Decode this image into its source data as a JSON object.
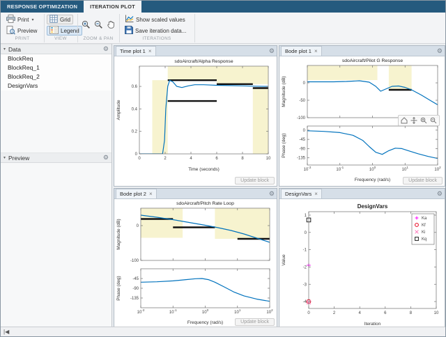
{
  "window": {
    "tab_response": "RESPONSE OPTIMIZATION",
    "tab_iteration": "ITERATION PLOT"
  },
  "toolbar": {
    "print_label": "Print",
    "preview_label": "Preview",
    "grid_label": "Grid",
    "legend_label": "Legend",
    "show_scaled_label": "Show scaled values",
    "save_iteration_label": "Save iteration data...",
    "section_print": "PRINT",
    "section_view": "VIEW",
    "section_zoom": "ZOOM & PAN",
    "section_iterations": "ITERATIONS"
  },
  "icons": {
    "gear": "⚙",
    "collapse": "▾",
    "dropdown": "▾",
    "close": "×",
    "status_nav": "|◀"
  },
  "sidebar": {
    "data_header": "Data",
    "preview_header": "Preview",
    "items": [
      "BlockReq",
      "BlockReq_1",
      "BlockReq_2",
      "DesignVars"
    ]
  },
  "panels": {
    "update_label": "Update block",
    "timeplot": {
      "tab_label": "Time plot 1"
    },
    "bode1": {
      "tab_label": "Bode plot 1"
    },
    "bode2": {
      "tab_label": "Bode plot 2"
    },
    "designvars": {
      "tab_label": "DesignVars"
    }
  },
  "statusbar": {
    "nav": "|◀"
  },
  "chart_data": [
    {
      "id": "timeplot",
      "type": "line",
      "title": "sdoAircraft/Alpha Response",
      "xlabel": "Time (seconds)",
      "ylabel": "Amplitude",
      "xscale": "linear",
      "xlim": [
        0,
        10
      ],
      "ylim": [
        0,
        0.78
      ],
      "xticks": [
        0,
        2,
        4,
        6,
        8,
        10
      ],
      "yticks": [
        0,
        0.2,
        0.4,
        0.6
      ],
      "region_color": "#f7f3cf",
      "regions": [
        [
          1,
          2.2,
          0,
          0.655
        ],
        [
          2.2,
          6,
          0.655,
          0.78
        ],
        [
          6,
          10,
          0.62,
          0.78
        ],
        [
          8.8,
          10,
          0,
          0.585
        ]
      ],
      "bounds": [
        [
          2.2,
          6,
          0.655
        ],
        [
          6,
          8.8,
          0.62
        ],
        [
          2.2,
          6,
          0.47
        ],
        [
          8.8,
          10,
          0.585
        ]
      ],
      "series": [
        {
          "name": "response",
          "color": "#0072bd",
          "points": [
            [
              0,
              0
            ],
            [
              1.8,
              0
            ],
            [
              1.95,
              0.12
            ],
            [
              2.05,
              0.4
            ],
            [
              2.2,
              0.6
            ],
            [
              2.35,
              0.655
            ],
            [
              2.6,
              0.64
            ],
            [
              2.9,
              0.6
            ],
            [
              3.3,
              0.59
            ],
            [
              3.8,
              0.605
            ],
            [
              4.3,
              0.615
            ],
            [
              5,
              0.615
            ],
            [
              6,
              0.61
            ],
            [
              7,
              0.607
            ],
            [
              8,
              0.605
            ],
            [
              9,
              0.602
            ],
            [
              10,
              0.6
            ]
          ]
        }
      ]
    },
    {
      "id": "bode1mag",
      "type": "line",
      "title": "sdoAircraft/Pilot G Response",
      "ylabel": "Magnitude (dB)",
      "xscale": "log",
      "xlim": [
        -2,
        2
      ],
      "ylim": [
        -100,
        50
      ],
      "xticks": [
        -2,
        -1,
        0,
        1,
        2
      ],
      "show_xlabels": false,
      "yticks": [
        0,
        -50,
        -100
      ],
      "regions": [
        [
          -2,
          0.15,
          8,
          50
        ],
        [
          0.5,
          1.2,
          -20,
          50
        ]
      ],
      "bounds": [
        [
          0.5,
          1.2,
          -20
        ]
      ],
      "series": [
        {
          "color": "#0072bd",
          "points": [
            [
              -2,
              3
            ],
            [
              -1.2,
              3
            ],
            [
              -0.8,
              4
            ],
            [
              -0.4,
              6
            ],
            [
              -0.1,
              2
            ],
            [
              0.1,
              -10
            ],
            [
              0.25,
              -24
            ],
            [
              0.4,
              -18
            ],
            [
              0.6,
              -10
            ],
            [
              0.8,
              -9
            ],
            [
              1,
              -13
            ],
            [
              1.2,
              -20
            ],
            [
              1.5,
              -35
            ],
            [
              1.8,
              -52
            ],
            [
              2,
              -63
            ]
          ]
        }
      ]
    },
    {
      "id": "bode1phase",
      "type": "line",
      "ylabel": "Phase (deg)",
      "xlabel": "Frequency (rad/s)",
      "xscale": "log",
      "xlim": [
        -2,
        2
      ],
      "ylim": [
        -170,
        20
      ],
      "xticks": [
        -2,
        -1,
        0,
        1,
        2
      ],
      "yticks": [
        0,
        -45,
        -90,
        -135
      ],
      "series": [
        {
          "color": "#0072bd",
          "points": [
            [
              -2,
              -3
            ],
            [
              -1.5,
              -6
            ],
            [
              -1,
              -12
            ],
            [
              -0.6,
              -25
            ],
            [
              -0.3,
              -50
            ],
            [
              -0.1,
              -80
            ],
            [
              0.1,
              -108
            ],
            [
              0.3,
              -118
            ],
            [
              0.5,
              -100
            ],
            [
              0.7,
              -88
            ],
            [
              0.9,
              -90
            ],
            [
              1.1,
              -100
            ],
            [
              1.4,
              -115
            ],
            [
              1.7,
              -128
            ],
            [
              2,
              -138
            ]
          ]
        }
      ]
    },
    {
      "id": "bode2mag",
      "type": "line",
      "title": "sdoAircraft/Pitch Rate Loop",
      "ylabel": "Magnitude (dB)",
      "xscale": "log",
      "xlim": [
        -2,
        2
      ],
      "ylim": [
        -100,
        50
      ],
      "xticks": [
        -2,
        -1,
        0,
        1,
        2
      ],
      "show_xlabels": false,
      "yticks": [
        0,
        -100
      ],
      "regions": [
        [
          -2,
          -0.7,
          -35,
          50
        ],
        [
          0.3,
          2,
          -38,
          50
        ]
      ],
      "bounds": [
        [
          -2,
          -1,
          19
        ],
        [
          -1,
          0.3,
          -5
        ],
        [
          1,
          2,
          -38
        ]
      ],
      "series": [
        {
          "color": "#0072bd",
          "points": [
            [
              -2,
              30
            ],
            [
              -1.5,
              24
            ],
            [
              -1,
              17
            ],
            [
              -0.5,
              9
            ],
            [
              0,
              1
            ],
            [
              0.4,
              -6
            ],
            [
              0.8,
              -14
            ],
            [
              1.2,
              -24
            ],
            [
              1.6,
              -36
            ],
            [
              2,
              -48
            ]
          ]
        }
      ]
    },
    {
      "id": "bode2phase",
      "type": "line",
      "ylabel": "Phase (deg)",
      "xlabel": "Frequency (rad/s)",
      "xscale": "log",
      "xlim": [
        -2,
        2
      ],
      "ylim": [
        -180,
        0
      ],
      "xticks": [
        -2,
        -1,
        0,
        1,
        2
      ],
      "yticks": [
        -45,
        -90,
        -135
      ],
      "series": [
        {
          "color": "#0072bd",
          "points": [
            [
              -2,
              -62
            ],
            [
              -1.5,
              -60
            ],
            [
              -1,
              -56
            ],
            [
              -0.6,
              -50
            ],
            [
              -0.3,
              -46
            ],
            [
              -0.1,
              -45
            ],
            [
              0.1,
              -50
            ],
            [
              0.3,
              -62
            ],
            [
              0.6,
              -85
            ],
            [
              0.9,
              -108
            ],
            [
              1.2,
              -125
            ],
            [
              1.6,
              -140
            ],
            [
              2,
              -150
            ]
          ]
        }
      ]
    },
    {
      "id": "designvars",
      "type": "scatter",
      "title": "DesignVars",
      "title_bold": true,
      "xlabel": "Iteration",
      "ylabel": "Value",
      "xscale": "linear",
      "xlim": [
        0,
        10
      ],
      "ylim": [
        -4.4,
        1.2
      ],
      "xticks": [
        0,
        2,
        4,
        6,
        8,
        10
      ],
      "yticks": [
        1,
        0,
        -1,
        -2,
        -3,
        -4
      ],
      "legend": true,
      "series": [
        {
          "name": "Ka",
          "color": "#ff00ff",
          "marker": "plus",
          "points": [
            [
              0,
              -1.9
            ]
          ]
        },
        {
          "name": "Kf",
          "color": "#e8001c",
          "marker": "circle",
          "points": [
            [
              0,
              -4.0
            ]
          ]
        },
        {
          "name": "Ki",
          "color": "#ff80c0",
          "marker": "x",
          "points": [
            [
              0,
              -4.05
            ]
          ]
        },
        {
          "name": "Kq",
          "color": "#202020",
          "marker": "square",
          "points": [
            [
              0,
              0.72
            ]
          ]
        }
      ]
    }
  ]
}
